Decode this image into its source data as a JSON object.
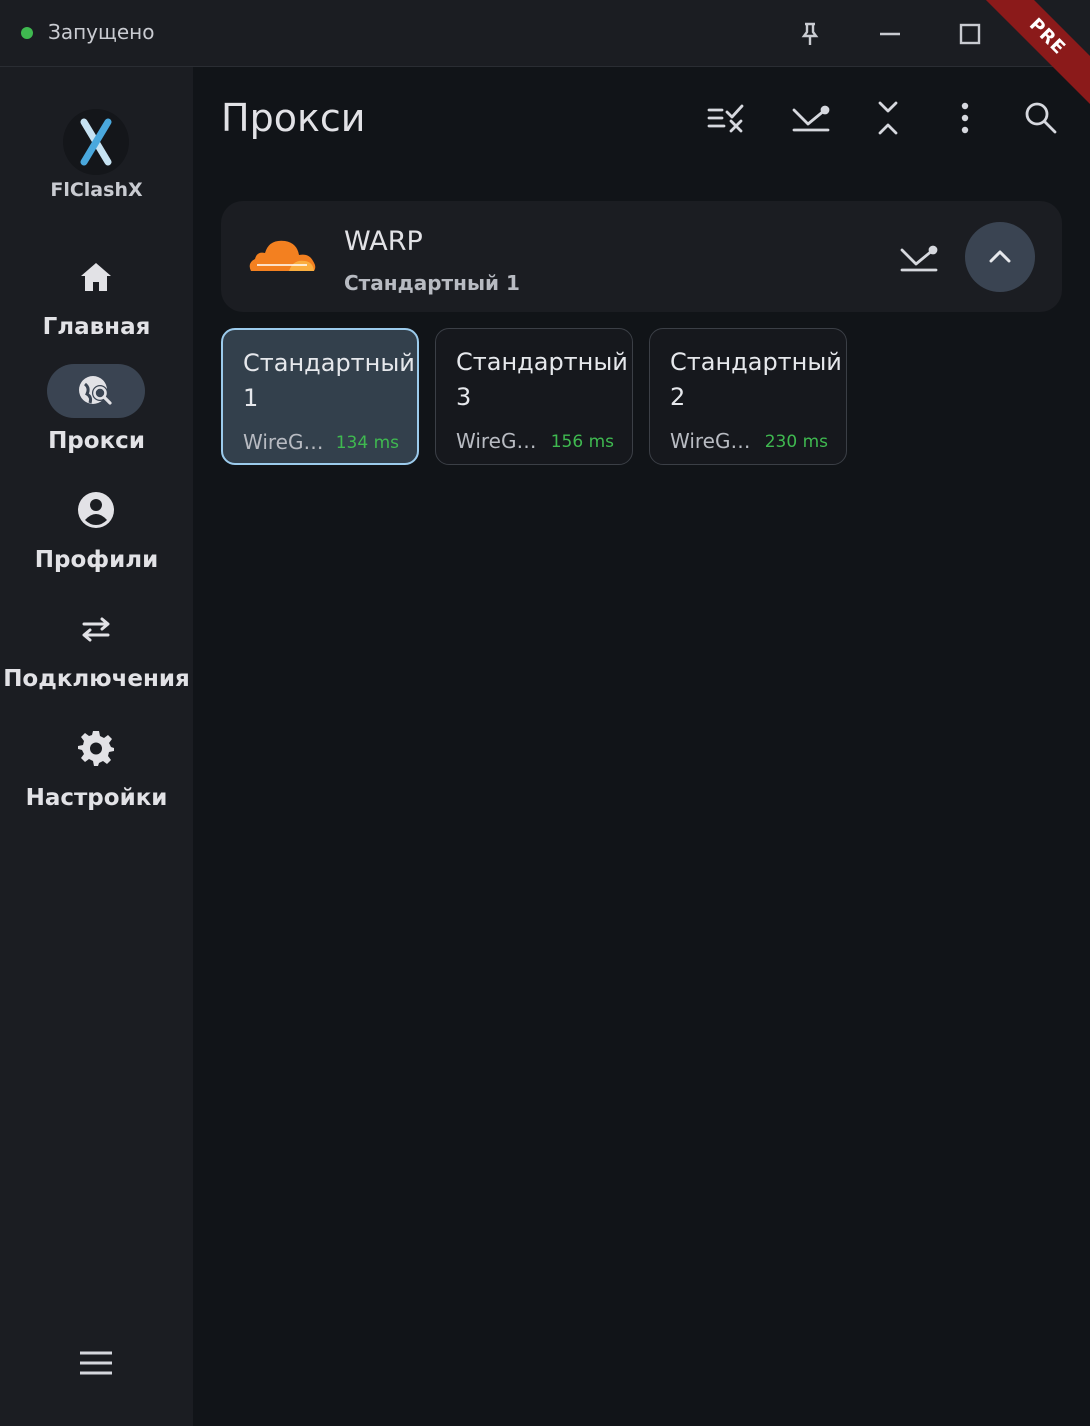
{
  "titlebar": {
    "status_text": "Запущено",
    "status_color": "#3fb950",
    "ribbon": "PRE"
  },
  "sidebar": {
    "app_name": "FlClashX",
    "items": [
      {
        "label": "Главная",
        "icon": "home-icon"
      },
      {
        "label": "Прокси",
        "icon": "proxy-search-icon",
        "active": true
      },
      {
        "label": "Профили",
        "icon": "account-icon"
      },
      {
        "label": "Подключения",
        "icon": "swap-arrows-icon"
      },
      {
        "label": "Настройки",
        "icon": "gear-icon"
      }
    ],
    "menu_icon": "hamburger-icon"
  },
  "header": {
    "title": "Прокси",
    "actions": [
      "checklist-clear-icon",
      "speed-test-icon",
      "collapse-all-icon",
      "more-vert-icon",
      "search-icon"
    ]
  },
  "group": {
    "name": "WARP",
    "selected": "Стандартный 1",
    "icon": "cloudflare-cloud-icon"
  },
  "proxies": [
    {
      "name_line1": "Стандартный",
      "name_line2": "1",
      "type": "WireGuard",
      "delay": "134 ms",
      "selected": true
    },
    {
      "name_line1": "Стандартный",
      "name_line2": "3",
      "type": "WireGuard",
      "delay": "156 ms",
      "selected": false
    },
    {
      "name_line1": "Стандартный",
      "name_line2": "2",
      "type": "WireGuard",
      "delay": "230 ms",
      "selected": false
    }
  ]
}
